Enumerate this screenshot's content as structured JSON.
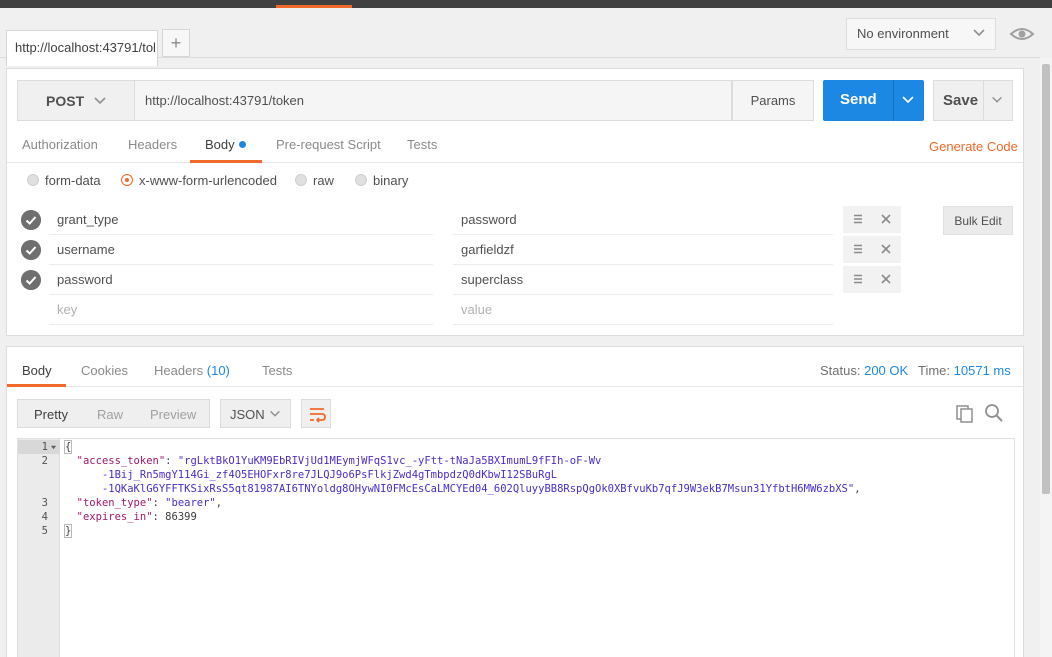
{
  "tabs": {
    "request_tab_label": "http://localhost:43791/tol",
    "add_tab_label": "+"
  },
  "environment": {
    "selected": "No environment"
  },
  "request": {
    "method": "POST",
    "url": "http://localhost:43791/token",
    "params_label": "Params",
    "send_label": "Send",
    "save_label": "Save",
    "generate_code_label": "Generate Code",
    "tabs": [
      "Authorization",
      "Headers",
      "Body",
      "Pre-request Script",
      "Tests"
    ],
    "active_tab": "Body",
    "body_modes": [
      "form-data",
      "x-www-form-urlencoded",
      "raw",
      "binary"
    ],
    "selected_body_mode": "x-www-form-urlencoded",
    "form_rows": [
      {
        "key": "grant_type",
        "value": "password"
      },
      {
        "key": "username",
        "value": "garfieldzf"
      },
      {
        "key": "password",
        "value": "superclass"
      }
    ],
    "key_placeholder": "key",
    "value_placeholder": "value",
    "bulk_edit_label": "Bulk Edit"
  },
  "response": {
    "tabs": {
      "body": "Body",
      "cookies": "Cookies",
      "headers": "Headers",
      "headers_count": "(10)",
      "tests": "Tests"
    },
    "status_label": "Status:",
    "status_value": "200 OK",
    "time_label": "Time:",
    "time_value": "10571 ms",
    "view_modes": [
      "Pretty",
      "Raw",
      "Preview"
    ],
    "active_view": "Pretty",
    "format": "JSON",
    "line_numbers": [
      "1",
      "2",
      "3",
      "4",
      "5"
    ],
    "code": {
      "open_brace": "{",
      "access_token_key": "\"access_token\"",
      "access_token_line1": "\"rgLktBkO1YuKM9EbRIVjUd1MEymjWFqS1vc_-yFtt-tNaJa5BXImumL9fFIh-oF-Wv",
      "access_token_line2": "-1Bij_Rn5mgY114Gi_zf4O5EHOFxr8re7JLQJ9o6PsFlkjZwd4gTmbpdzQ0dKbwI12SBuRgL",
      "access_token_line3": "-1QKaKlG6YFFTKSixRsS5qt81987AI6TNYoldg8OHywNI0FMcEsCaLMCYEd04_602QluyyBB8RspQgOk0XBfvuKb7qfJ9W3ekB7Msun31YfbtH6MW6zbXS\"",
      "token_type_key": "\"token_type\"",
      "token_type_value": "\"bearer\"",
      "expires_in_key": "\"expires_in\"",
      "expires_in_value": "86399",
      "close_brace": "}"
    }
  },
  "colors": {
    "accent_orange": "#ef6a2b",
    "send_blue": "#1d87e4",
    "json_key": "#a0186a",
    "json_string": "#4a2dc8"
  },
  "icons": [
    "chevron-down-icon",
    "eye-icon",
    "check-circle-icon",
    "drag-handle-icon",
    "close-icon",
    "wrap-lines-icon",
    "copy-icon",
    "search-icon",
    "fold-arrow-icon"
  ]
}
